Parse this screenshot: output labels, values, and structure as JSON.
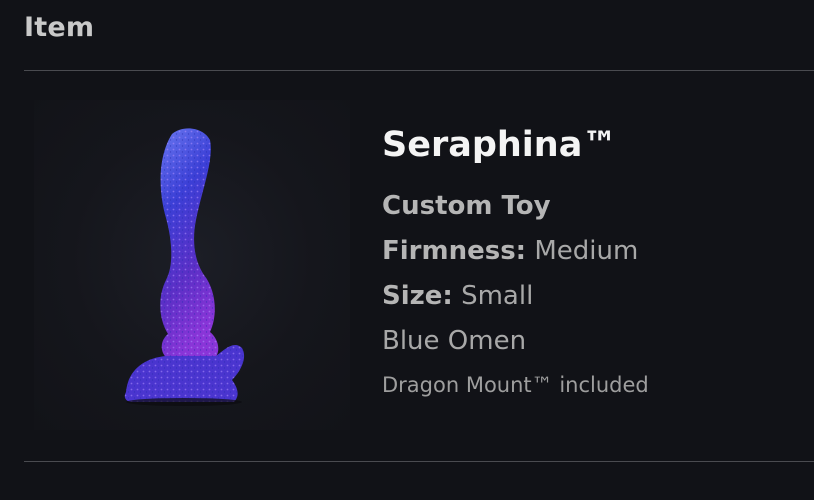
{
  "section": {
    "title": "Item"
  },
  "product": {
    "image_icon": "product-photo",
    "name": "Seraphina™",
    "type": "Custom Toy",
    "firmness_label": "Firmness:",
    "firmness_value": "Medium",
    "size_label": "Size:",
    "size_value": "Small",
    "color": "Blue Omen",
    "note": "Dragon Mount™ included"
  },
  "colors": {
    "background": "#111217",
    "title_text": "#f4f4f4",
    "body_text": "#a8a8a8",
    "divider": "#4a4b50",
    "product_blue": "#3a3fd8",
    "product_purple": "#8a2fd0"
  }
}
